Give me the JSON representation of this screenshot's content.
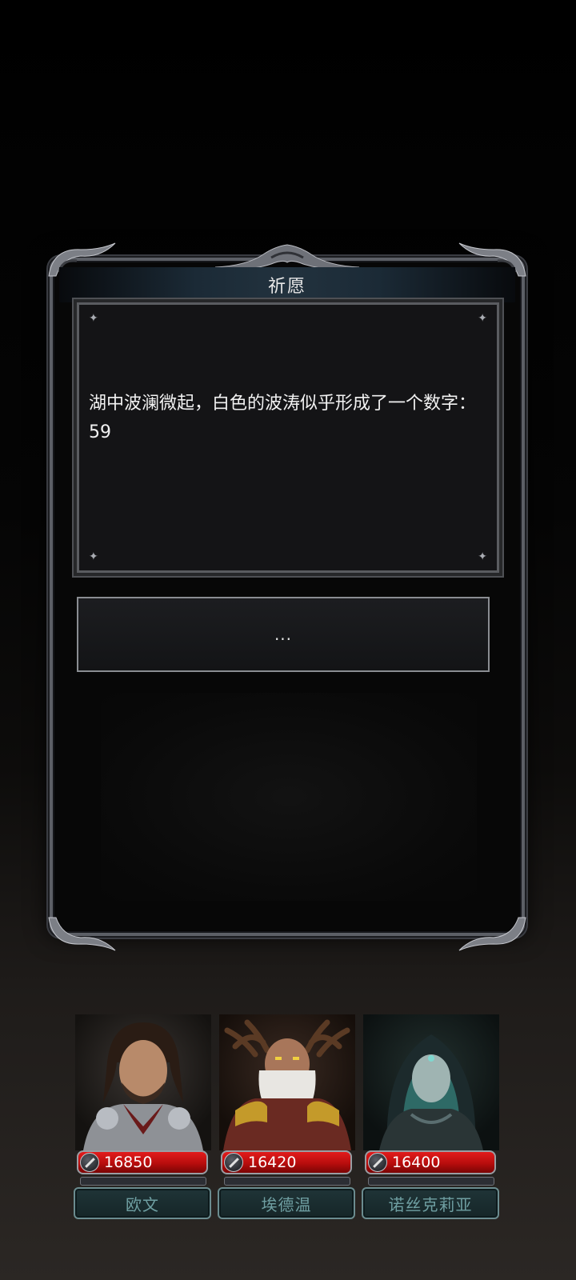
{
  "dialog": {
    "title": "祈愿",
    "message": "湖中波澜微起，白色的波涛似乎形成了一个数字：59",
    "choice_label": "..."
  },
  "party": [
    {
      "name": "欧文",
      "hp": "16850"
    },
    {
      "name": "埃德温",
      "hp": "16420"
    },
    {
      "name": "诺丝克莉亚",
      "hp": "16400"
    }
  ],
  "icons": {
    "hp_icon": "sword-icon",
    "corner_ornament": "sparkle-icon"
  }
}
